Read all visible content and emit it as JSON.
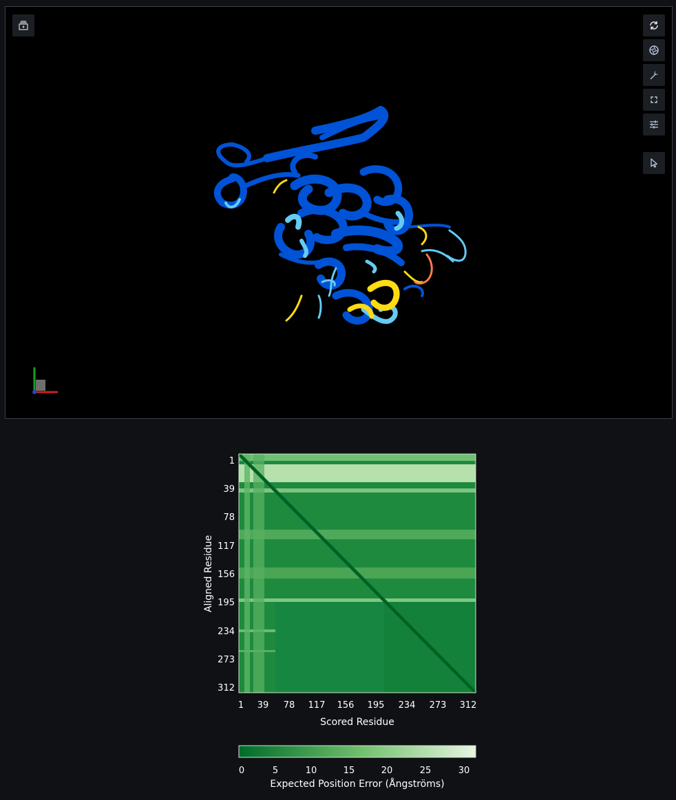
{
  "viewer": {
    "toolbar_left": [
      {
        "name": "screenshot-icon"
      }
    ],
    "toolbar_right": [
      {
        "name": "reset-view-icon"
      },
      {
        "name": "snapshot-icon"
      },
      {
        "name": "tools-icon"
      },
      {
        "name": "fullscreen-icon"
      },
      {
        "name": "settings-sliders-icon"
      },
      {
        "name": "select-cursor-icon"
      }
    ],
    "colors": {
      "very_high": "#0053d6",
      "confident": "#65cbf3",
      "low": "#ffdb13",
      "very_low": "#ff7d45"
    }
  },
  "pae": {
    "ylabel": "Aligned Residue",
    "xlabel": "Scored Residue",
    "colorbar_label": "Expected Position Error (Ångströms)"
  },
  "chart_data": {
    "type": "heatmap",
    "xlabel": "Scored Residue",
    "ylabel": "Aligned Residue",
    "x_ticks": [
      "1",
      "39",
      "78",
      "117",
      "156",
      "195",
      "234",
      "273",
      "312"
    ],
    "y_ticks": [
      "1",
      "39",
      "78",
      "117",
      "156",
      "195",
      "234",
      "273",
      "312"
    ],
    "residue_range": [
      1,
      325
    ],
    "colorbar": {
      "label": "Expected Position Error (Ångströms)",
      "ticks": [
        "0",
        "5",
        "10",
        "15",
        "20",
        "25",
        "30"
      ],
      "range": [
        0,
        31.75
      ],
      "color_low": "#006b2a",
      "color_high": "#e8f5e0"
    }
  }
}
